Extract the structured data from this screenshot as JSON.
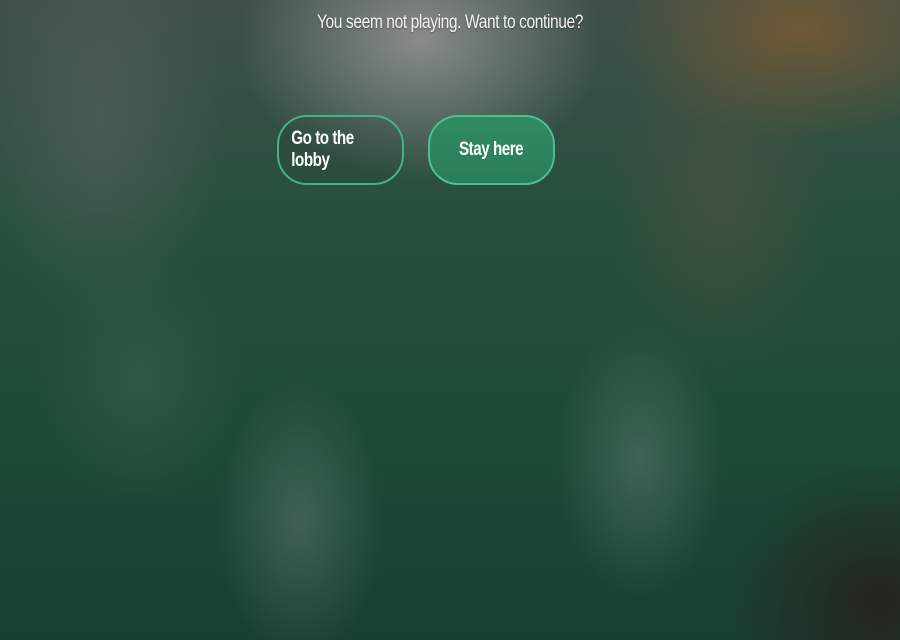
{
  "dialog": {
    "message": "You seem not playing. Want to continue?",
    "buttons": {
      "lobby_label": "Go to the lobby",
      "stay_label": "Stay here"
    }
  },
  "colors": {
    "accent": "#3fb583",
    "primary_button": "#2f8a62"
  }
}
